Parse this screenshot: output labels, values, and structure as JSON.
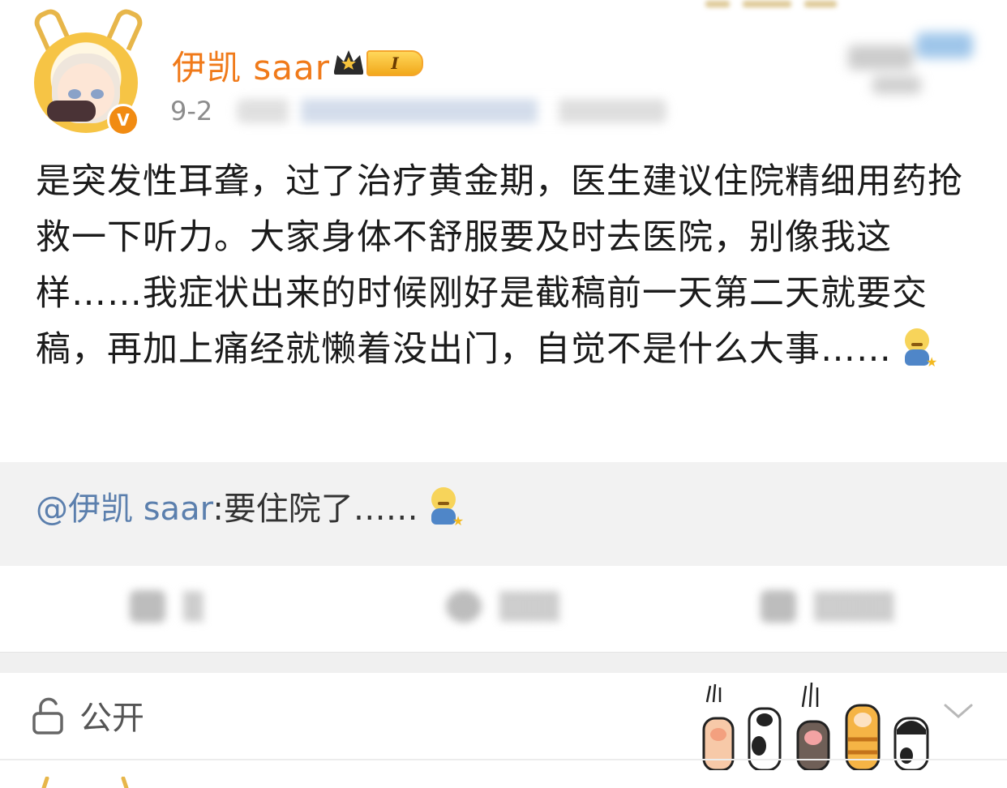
{
  "post": {
    "username": "伊凯 saar",
    "level": "I",
    "date": "9-2",
    "verified_mark": "V",
    "content": "是突发性耳聋，过了治疗黄金期，医生建议住院精细用药抢救一下听力。大家身体不舒服要及时去医院，别像我这样……我症状出来的时候刚好是截稿前一天第二天就要交稿，再加上痛经就懒着没出门，自觉不是什么大事……",
    "content_emoji": "sad-kneeling-emoji"
  },
  "repost": {
    "mention": "@伊凯 saar",
    "text": ":要住院了……",
    "emoji": "sad-kneeling-emoji"
  },
  "visibility": {
    "label": "公开",
    "icon": "lock-open-icon",
    "dropdown_icon": "chevron-down-icon"
  },
  "colors": {
    "username": "#f07a1a",
    "mention": "#5b7fad",
    "repost_bg": "#f2f2f2",
    "verified": "#f18b12"
  }
}
